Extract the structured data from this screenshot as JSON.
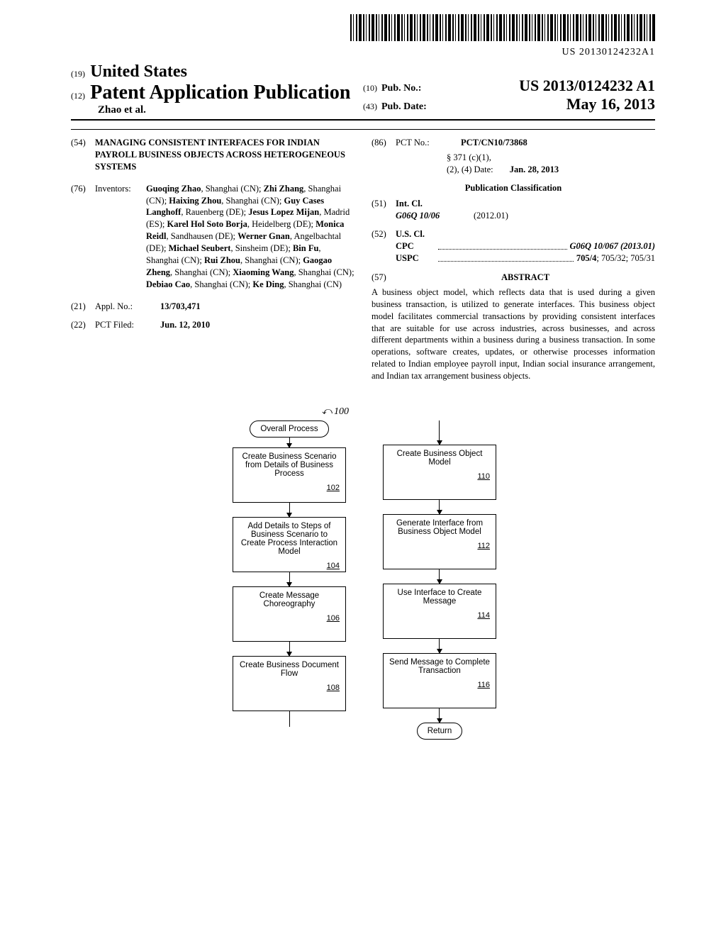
{
  "barcode_number": "US 20130124232A1",
  "header": {
    "code19": "(19)",
    "country": "United States",
    "code12": "(12)",
    "kind": "Patent Application Publication",
    "authors_line": "Zhao et al.",
    "code10": "(10)",
    "pubno_label": "Pub. No.:",
    "pubno": "US 2013/0124232 A1",
    "code43": "(43)",
    "pubdate_label": "Pub. Date:",
    "pubdate": "May 16, 2013"
  },
  "sec54": {
    "code": "(54)",
    "title": "MANAGING CONSISTENT INTERFACES FOR INDIAN PAYROLL BUSINESS OBJECTS ACROSS HETEROGENEOUS SYSTEMS"
  },
  "sec76": {
    "code": "(76)",
    "label": "Inventors:",
    "html": "<b>Guoqing Zhao</b>, Shanghai (CN); <b>Zhi Zhang</b>, Shanghai (CN); <b>Haixing Zhou</b>, Shanghai (CN); <b>Guy Cases Langhoff</b>, Rauenberg (DE); <b>Jesus Lopez Mijan</b>, Madrid (ES); <b>Karel Hol Soto Borja</b>, Heidelberg (DE); <b>Monica Reidl</b>, Sandhausen (DE); <b>Werner Gnan</b>, Angelbachtal (DE); <b>Michael Seubert</b>, Sinsheim (DE); <b>Bin Fu</b>, Shanghai (CN); <b>Rui Zhou</b>, Shanghai (CN); <b>Gaogao Zheng</b>, Shanghai (CN); <b>Xiaoming Wang</b>, Shanghai (CN); <b>Debiao Cao</b>, Shanghai (CN); <b>Ke Ding</b>, Shanghai (CN)"
  },
  "sec21": {
    "code": "(21)",
    "label": "Appl. No.:",
    "value": "13/703,471"
  },
  "sec22": {
    "code": "(22)",
    "label": "PCT Filed:",
    "value": "Jun. 12, 2010"
  },
  "sec86": {
    "code": "(86)",
    "label": "PCT No.:",
    "value": "PCT/CN10/73868",
    "sub1": "§ 371 (c)(1),",
    "sub2": "(2), (4) Date:",
    "sub2val": "Jan. 28, 2013"
  },
  "pubclass_heading": "Publication Classification",
  "sec51": {
    "code": "(51)",
    "label": "Int. Cl.",
    "cls": "G06Q 10/06",
    "ver": "(2012.01)"
  },
  "sec52": {
    "code": "(52)",
    "label": "U.S. Cl.",
    "cpc_k": "CPC",
    "cpc_v": "G06Q 10/067 (2013.01)",
    "uspc_k": "USPC",
    "uspc_v": "705/4; 705/32; 705/31"
  },
  "sec57": {
    "code": "(57)",
    "heading": "ABSTRACT",
    "body": "A business object model, which reflects data that is used during a given business transaction, is utilized to generate interfaces. This business object model facilitates commercial transactions by providing consistent interfaces that are suitable for use across industries, across businesses, and across different departments within a business during a business transaction. In some operations, software creates, updates, or otherwise processes information related to Indian employee payroll input, Indian social insurance arrangement, and Indian tax arrangement business objects."
  },
  "fig": {
    "ref": "100",
    "start": "Overall Process",
    "left": [
      {
        "text": "Create Business Scenario from Details of Business Process",
        "num": "102"
      },
      {
        "text": "Add Details to Steps of Business Scenario to Create Process Interaction Model",
        "num": "104"
      },
      {
        "text": "Create Message Choreography",
        "num": "106"
      },
      {
        "text": "Create Business Document Flow",
        "num": "108"
      }
    ],
    "right": [
      {
        "text": "Create Business Object Model",
        "num": "110"
      },
      {
        "text": "Generate Interface from Business Object Model",
        "num": "112"
      },
      {
        "text": "Use Interface to Create Message",
        "num": "114"
      },
      {
        "text": "Send Message to Complete Transaction",
        "num": "116"
      }
    ],
    "end": "Return"
  }
}
